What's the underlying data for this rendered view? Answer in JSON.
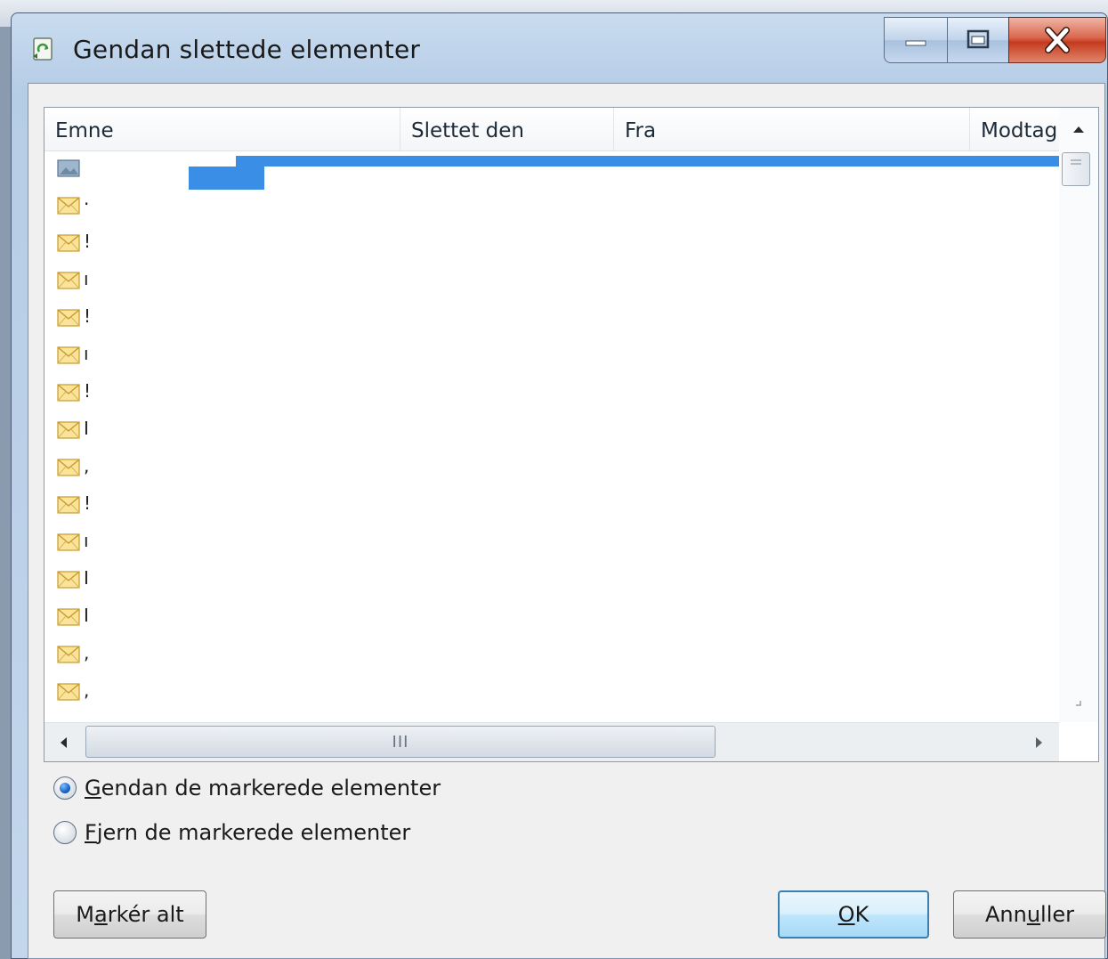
{
  "window": {
    "title": "Gendan slettede elementer",
    "icon": "recycle-restore-icon"
  },
  "caption_buttons": {
    "minimize_icon": "minimize-icon",
    "maximize_icon": "maximize-icon",
    "close_icon": "close-icon"
  },
  "list": {
    "columns": [
      "Emne",
      "Slettet den",
      "Fra",
      "Modtag"
    ],
    "selection_color": "#3a8ee6",
    "rows": [
      {
        "icon": "picture-item-icon",
        "text": "",
        "selected": true
      },
      {
        "icon": "mail-envelope-icon",
        "text": "·"
      },
      {
        "icon": "mail-envelope-icon",
        "text": "!"
      },
      {
        "icon": "mail-envelope-icon",
        "text": "ı"
      },
      {
        "icon": "mail-envelope-icon",
        "text": "!"
      },
      {
        "icon": "mail-envelope-icon",
        "text": "ı"
      },
      {
        "icon": "mail-envelope-icon",
        "text": "!"
      },
      {
        "icon": "mail-envelope-icon",
        "text": "I"
      },
      {
        "icon": "mail-envelope-icon",
        "text": ","
      },
      {
        "icon": "mail-envelope-icon",
        "text": "!"
      },
      {
        "icon": "mail-envelope-icon",
        "text": "ı"
      },
      {
        "icon": "mail-envelope-icon",
        "text": "I"
      },
      {
        "icon": "mail-envelope-icon",
        "text": "I"
      },
      {
        "icon": "mail-envelope-icon",
        "text": ","
      },
      {
        "icon": "mail-envelope-icon",
        "text": ","
      }
    ],
    "hscroll_thumb_grip": "III"
  },
  "options": {
    "restore_label_first": "G",
    "restore_label_rest": "endan de markerede elementer",
    "delete_label_first": "F",
    "delete_label_rest": "jern de markerede elementer",
    "selected": "restore"
  },
  "buttons": {
    "select_all_pre": "M",
    "select_all_mid": "a",
    "select_all_post": "rkér alt",
    "ok_first": "O",
    "ok_rest": "K",
    "cancel_pre": "Ann",
    "cancel_mid": "u",
    "cancel_post": "ller"
  }
}
